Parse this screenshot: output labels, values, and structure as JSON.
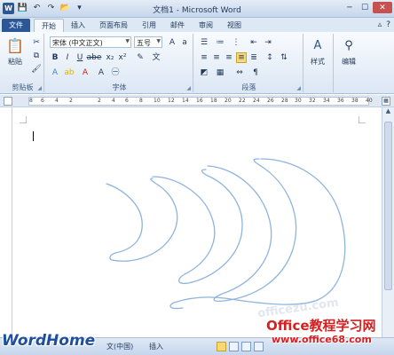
{
  "window": {
    "title": "文档1 - Microsoft Word"
  },
  "tabs": [
    {
      "label": "文件"
    },
    {
      "label": "开始"
    },
    {
      "label": "插入"
    },
    {
      "label": "页面布局"
    },
    {
      "label": "引用"
    },
    {
      "label": "邮件"
    },
    {
      "label": "审阅"
    },
    {
      "label": "视图"
    }
  ],
  "ribbon": {
    "clipboard": {
      "label": "剪贴板",
      "paste_label": "粘贴"
    },
    "font": {
      "label": "字体",
      "font_name": "宋体 (中文正文)",
      "font_size": "五号"
    },
    "paragraph": {
      "label": "段落"
    },
    "styles": {
      "label": "样式"
    },
    "editing": {
      "label": "编辑"
    }
  },
  "ruler": {
    "numbers": [
      "8",
      "6",
      "4",
      "2",
      "",
      "2",
      "4",
      "6",
      "8",
      "10",
      "12",
      "14",
      "16",
      "18",
      "20",
      "22",
      "24",
      "26",
      "28",
      "30",
      "32",
      "34",
      "36",
      "38",
      "40"
    ]
  },
  "statusbar": {
    "language": "文(中国)",
    "mode": "插入"
  },
  "watermarks": {
    "left": "WordHome",
    "right_title": "Office教程学习网",
    "right_url": "www.office68.com",
    "faint": "officezu.com"
  },
  "colors": {
    "file_tab": "#2b5797",
    "drawing_stroke": "#8eb4de",
    "watermark_red": "#d42020",
    "watermark_blue": "#1e4f9e"
  }
}
